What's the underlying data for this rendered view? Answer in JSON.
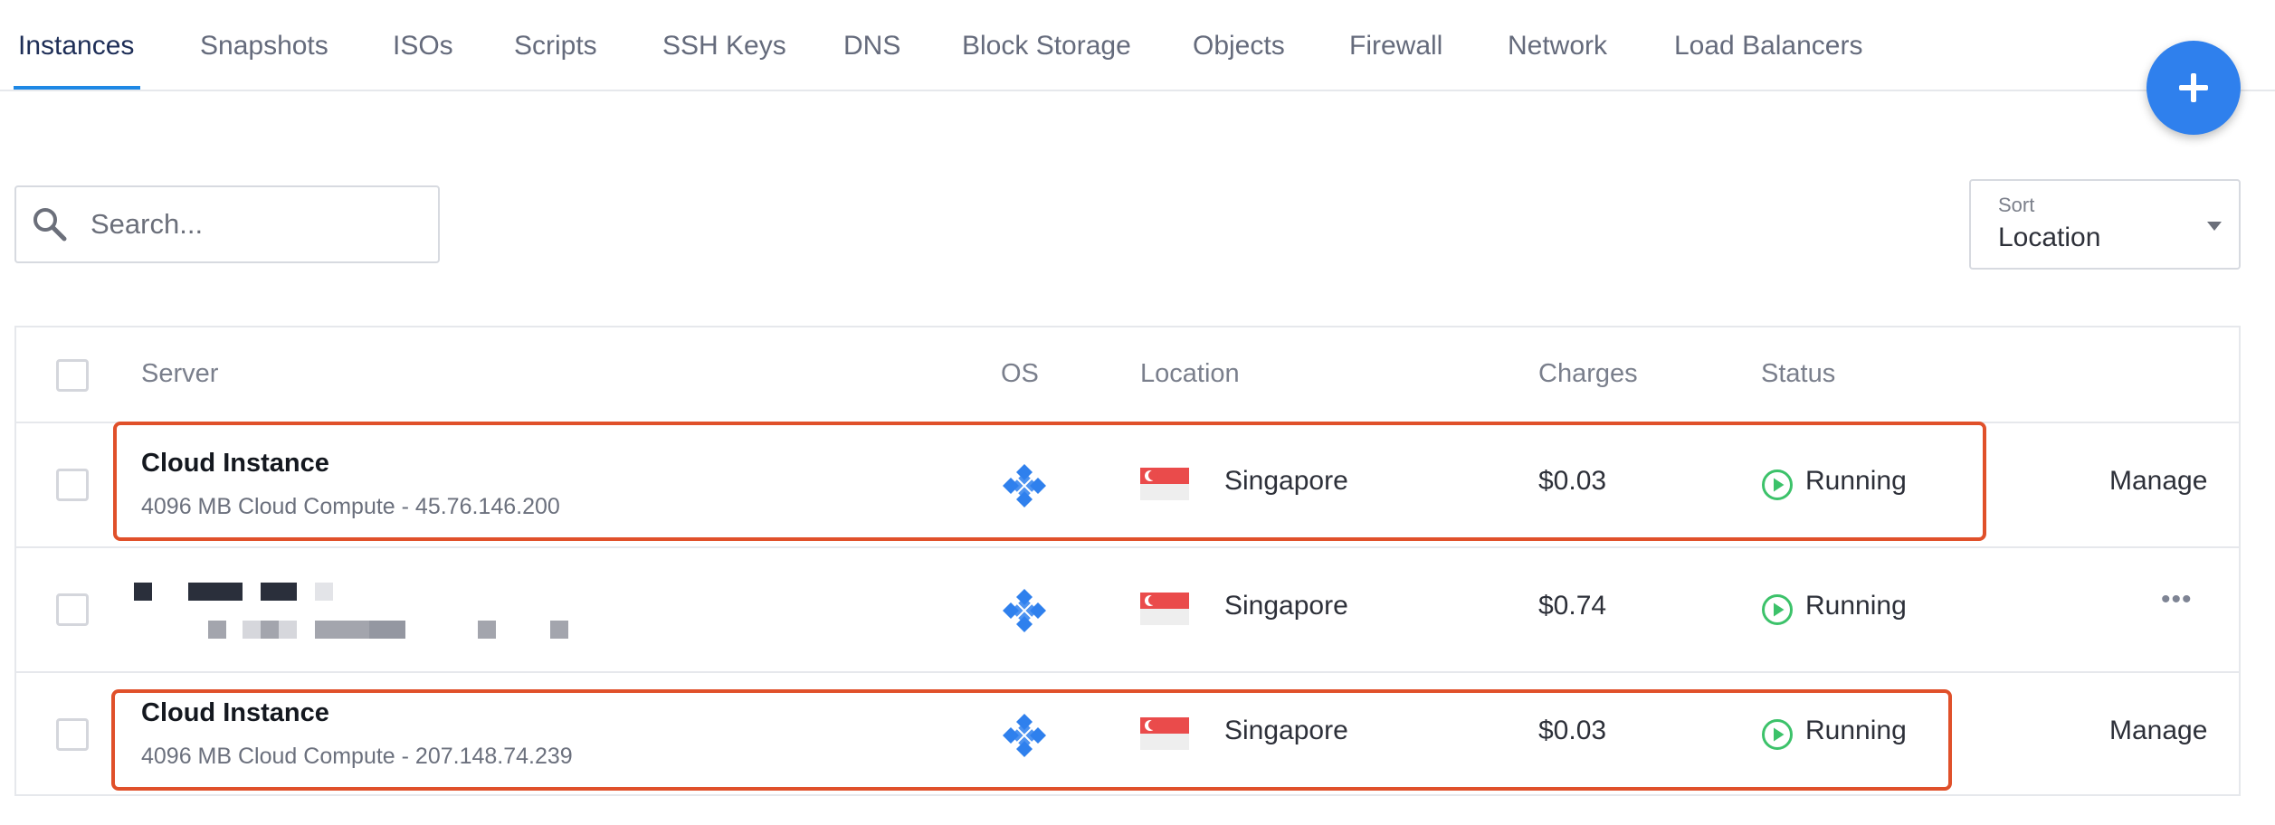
{
  "tabs": [
    {
      "label": "Instances",
      "active": true
    },
    {
      "label": "Snapshots",
      "active": false
    },
    {
      "label": "ISOs",
      "active": false
    },
    {
      "label": "Scripts",
      "active": false
    },
    {
      "label": "SSH Keys",
      "active": false
    },
    {
      "label": "DNS",
      "active": false
    },
    {
      "label": "Block Storage",
      "active": false
    },
    {
      "label": "Objects",
      "active": false
    },
    {
      "label": "Firewall",
      "active": false
    },
    {
      "label": "Network",
      "active": false
    },
    {
      "label": "Load Balancers",
      "active": false
    }
  ],
  "add_button": {
    "icon": "plus-icon"
  },
  "search": {
    "placeholder": "Search...",
    "value": "",
    "icon": "search-icon"
  },
  "sort": {
    "label": "Sort",
    "value": "Location",
    "icon": "caret-down-icon"
  },
  "table": {
    "columns": [
      "Server",
      "OS",
      "Location",
      "Charges",
      "Status"
    ],
    "rows": [
      {
        "name": "Cloud Instance",
        "detail": "4096 MB Cloud Compute - 45.76.146.200",
        "os_icon": "os-logo-icon",
        "flag_icon": "singapore-flag-icon",
        "location": "Singapore",
        "charges": "$0.03",
        "status": "Running",
        "action": "Manage",
        "highlighted": true
      },
      {
        "name": "",
        "detail": "",
        "redacted": true,
        "os_icon": "os-logo-icon",
        "flag_icon": "singapore-flag-icon",
        "location": "Singapore",
        "charges": "$0.74",
        "status": "Running",
        "action": "•••",
        "highlighted": false
      },
      {
        "name": "Cloud Instance",
        "detail": "4096 MB Cloud Compute - 207.148.74.239",
        "os_icon": "os-logo-icon",
        "flag_icon": "singapore-flag-icon",
        "location": "Singapore",
        "charges": "$0.03",
        "status": "Running",
        "action": "Manage",
        "highlighted": true
      }
    ]
  },
  "colors": {
    "accent": "#2f80ed",
    "tab_active": "#1e2e57",
    "status_running": "#3cc26a",
    "highlight": "#e0502a",
    "os_icon": "#2f80ed"
  }
}
